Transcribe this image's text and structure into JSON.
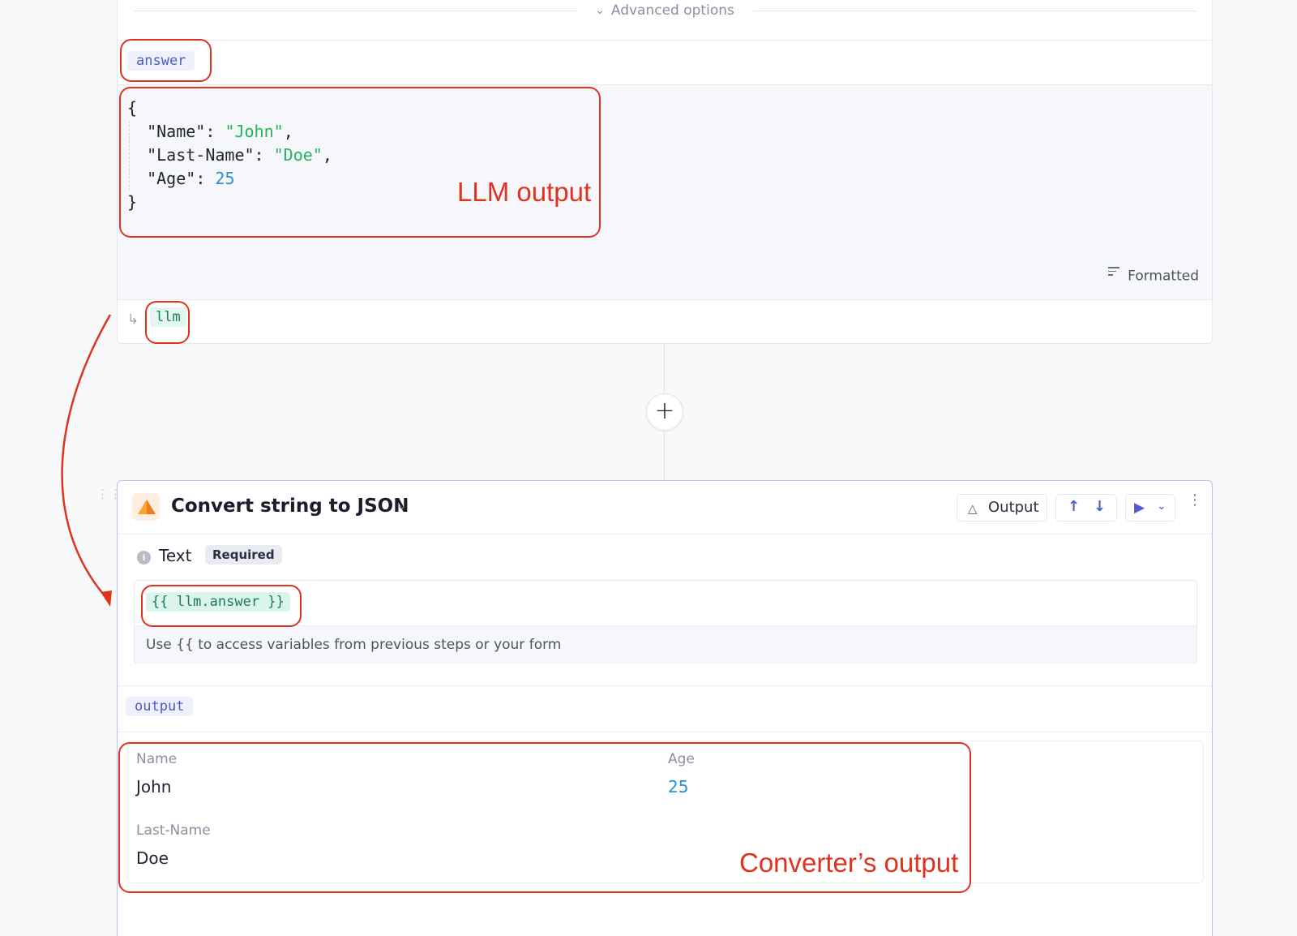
{
  "top_step": {
    "advanced_options_label": "Advanced options",
    "answer_chip": "answer",
    "code_lines": {
      "open": "{",
      "name_key": "\"Name\"",
      "name_val": "\"John\"",
      "last_key": "\"Last-Name\"",
      "last_val": "\"Doe\"",
      "age_key": "\"Age\"",
      "age_val": "25",
      "close": "}"
    },
    "formatted_label": "Formatted",
    "step_ref_chip": "llm"
  },
  "add_step_symbol": "+",
  "converter_step": {
    "title": "Convert string to JSON",
    "output_button": "Output",
    "field": {
      "label": "Text",
      "required_badge": "Required",
      "value": "{{ llm.answer }}",
      "hint": "Use {{ to access variables from previous steps or your form"
    },
    "output_chip": "output",
    "result": {
      "name_label": "Name",
      "name_value": "John",
      "age_label": "Age",
      "age_value": "25",
      "last_name_label": "Last-Name",
      "last_name_value": "Doe"
    }
  },
  "annotations": {
    "llm_output": "LLM output",
    "converter_output": "Converter’s output",
    "color": "#e0321f"
  },
  "icons": [
    "chevron-down-icon",
    "formatted-lines-icon",
    "return-arrow-icon",
    "plus-icon",
    "drag-handle-icon",
    "step-logo-icon",
    "flask-icon",
    "arrow-up-icon",
    "arrow-down-icon",
    "play-icon",
    "kebab-menu-icon",
    "info-icon"
  ],
  "colors": {
    "accent": "#4f5bd5",
    "chip_purple_bg": "#eef0fb",
    "chip_green_bg": "#e2f7ef",
    "string_green": "#25b25a",
    "number_blue": "#2b8fd6"
  }
}
